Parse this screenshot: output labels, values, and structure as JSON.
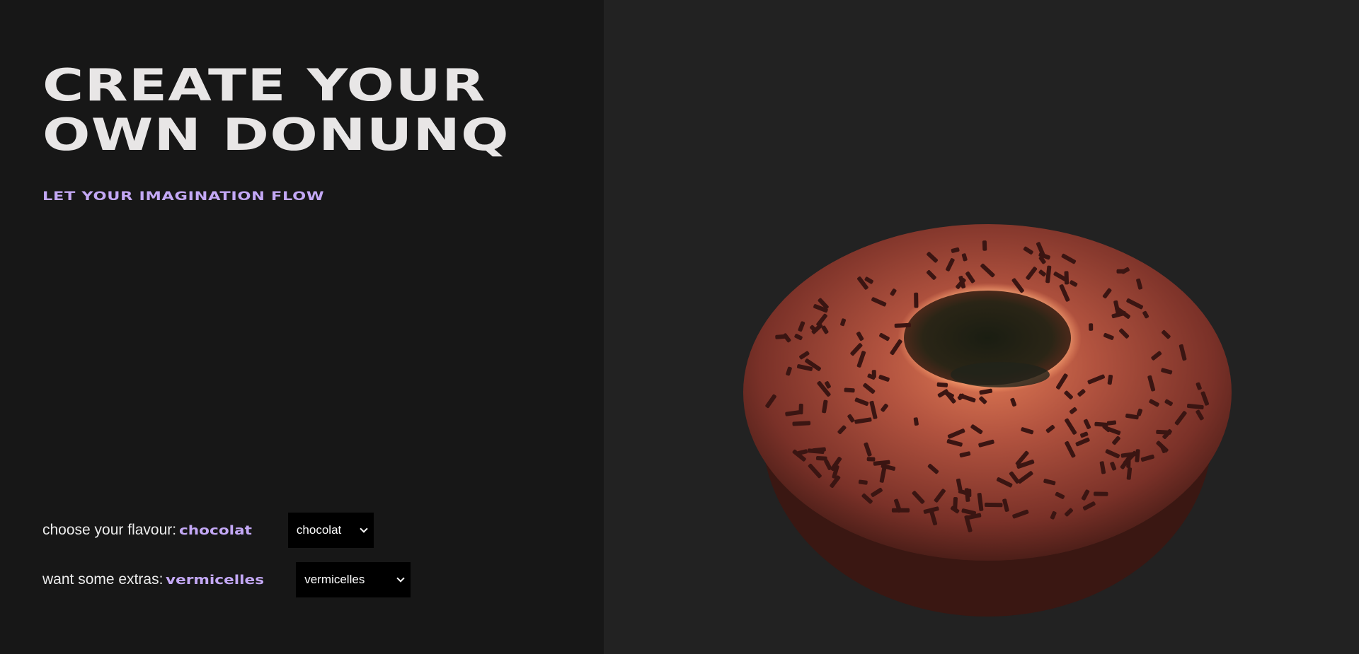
{
  "hero": {
    "title_line1": "CREATE YOUR",
    "title_line2": "OWN DONUNQ",
    "tagline": "LET YOUR IMAGINATION FLOW"
  },
  "options": {
    "flavour": {
      "label": "choose your flavour:",
      "value": "chocolat",
      "selected": "chocolat"
    },
    "extras": {
      "label": "want some extras:",
      "value": "vermicelles",
      "selected": "vermicelles"
    }
  },
  "colors": {
    "accent": "#c3a8f5",
    "left_bg": "#171717",
    "right_bg": "#222222",
    "donut_glaze": "#a04a38",
    "sprinkle": "#3a1512"
  }
}
